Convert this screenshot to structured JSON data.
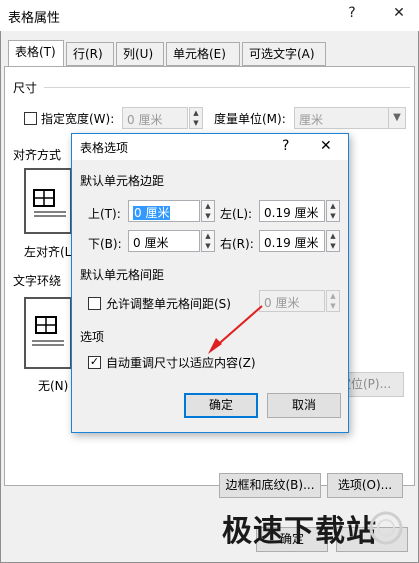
{
  "window": {
    "title": "表格属性",
    "help": "?",
    "close": "✕"
  },
  "tabs": [
    {
      "label": "表格(T)"
    },
    {
      "label": "行(R)"
    },
    {
      "label": "列(U)"
    },
    {
      "label": "单元格(E)"
    },
    {
      "label": "可选文字(A)"
    }
  ],
  "size": {
    "section": "尺寸",
    "preferred_width_label": "指定宽度(W):",
    "preferred_width_value": "0 厘米",
    "measure_label": "度量单位(M):",
    "measure_value": "厘米"
  },
  "alignment": {
    "section": "对齐方式",
    "left_label": "左对齐(L)"
  },
  "wrapping": {
    "section": "文字环绕",
    "none_label": "无(N)",
    "position_button": "定位(P)..."
  },
  "bottom_buttons": {
    "borders": "边框和底纹(B)...",
    "options": "选项(O)...",
    "ok": "确定"
  },
  "dialog": {
    "title": "表格选项",
    "help": "?",
    "close": "✕",
    "margins_section": "默认单元格边距",
    "top_label": "上(T):",
    "top_value": "0 厘米",
    "left_label": "左(L):",
    "left_value": "0.19 厘米",
    "bottom_label": "下(B):",
    "bottom_value": "0 厘米",
    "right_label": "右(R):",
    "right_value": "0.19 厘米",
    "spacing_section": "默认单元格间距",
    "allow_spacing_label": "允许调整单元格间距(S)",
    "spacing_value": "0 厘米",
    "options_section": "选项",
    "autoresize_label": "自动重调尺寸以适应内容(Z)",
    "ok": "确定",
    "cancel": "取消"
  },
  "watermark": {
    "text": "极速下载站"
  },
  "colors": {
    "accent": "#0078d7",
    "arrow": "#e02020",
    "selection": "#3399ff"
  }
}
